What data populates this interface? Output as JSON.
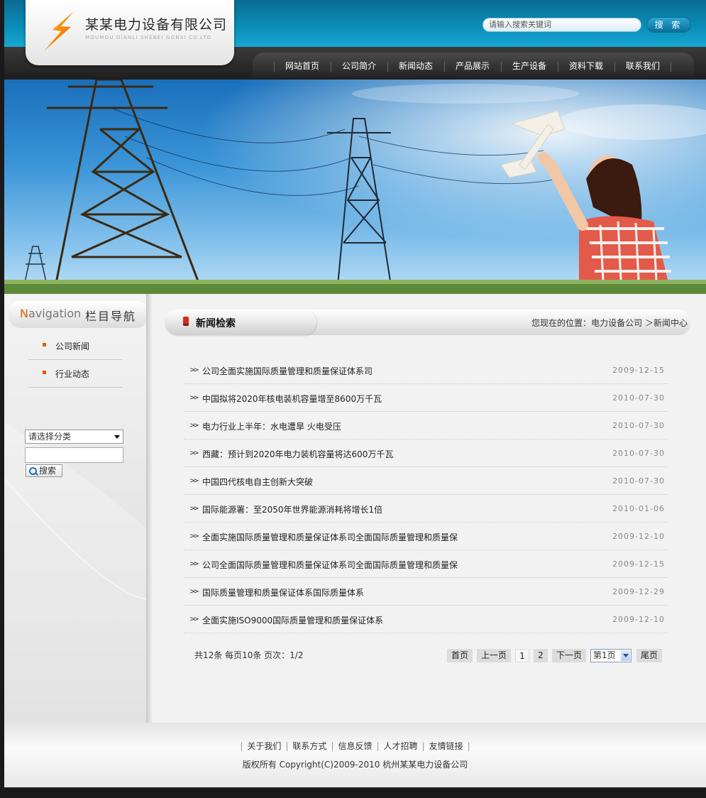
{
  "header": {
    "company_name": "某某电力设备有限公司",
    "company_name_en": "MOUMOU DIANLI SHEBEI GONSI CO.LTD",
    "search_placeholder": "请输入搜索关键词",
    "search_button": "搜 索"
  },
  "nav": {
    "items": [
      "网站首页",
      "公司简介",
      "新闻动态",
      "产品展示",
      "生产设备",
      "资料下载",
      "联系我们"
    ]
  },
  "sidebar": {
    "title_en_first": "N",
    "title_en_rest": "avigation",
    "title_cn": "栏目导航",
    "items": [
      "公司新闻",
      "行业动态"
    ],
    "category_select": "请选择分类",
    "search_button": "搜索"
  },
  "main": {
    "title": "新闻检索",
    "location_label": "您现在的位置：",
    "location_path": "电力设备公司 ＞新闻中心",
    "news": [
      {
        "title": "公司全面实施国际质量管理和质量保证体系司",
        "date": "2009-12-15"
      },
      {
        "title": "中国拟将2020年核电装机容量增至8600万千瓦",
        "date": "2010-07-30"
      },
      {
        "title": "电力行业上半年：水电遭旱 火电受压",
        "date": "2010-07-30"
      },
      {
        "title": "西藏：预计到2020年电力装机容量将达600万千瓦",
        "date": "2010-07-30"
      },
      {
        "title": "中国四代核电自主创新大突破",
        "date": "2010-07-30"
      },
      {
        "title": "国际能源署：至2050年世界能源消耗将增长1倍",
        "date": "2010-01-06"
      },
      {
        "title": "全面实施国际质量管理和质量保证体系司全面国际质量管理和质量保",
        "date": "2009-12-10"
      },
      {
        "title": "公司全面国际质量管理和质量保证体系司全面国际质量管理和质量保",
        "date": "2009-12-15"
      },
      {
        "title": "国际质量管理和质量保证体系国际质量体系",
        "date": "2009-12-29"
      },
      {
        "title": "全面实施ISO9000国际质量管理和质量保证体系",
        "date": "2009-12-10"
      }
    ],
    "pager": {
      "info": "共12条  每页10条  页次：1/2",
      "first": "首页",
      "prev": "上一页",
      "page1": "1",
      "page2": "2",
      "next": "下一页",
      "select": "第1页",
      "last": "尾页"
    }
  },
  "footer": {
    "links": [
      "关于我们",
      "联系方式",
      "信息反馈",
      "人才招聘",
      "友情链接"
    ],
    "copyright": "版权所有  Copyright(C)2009-2010 杭州某某电力设备公司"
  },
  "colors": {
    "header_blue": "#0a8fba",
    "nav_dark": "#222222",
    "accent_orange": "#e65c00",
    "title_icon_red": "#d52b1e"
  },
  "icons": [
    "lightning-logo-icon",
    "search-icon",
    "double-chevron-right-icon",
    "square-bullet-icon",
    "dropdown-arrow-icon"
  ]
}
